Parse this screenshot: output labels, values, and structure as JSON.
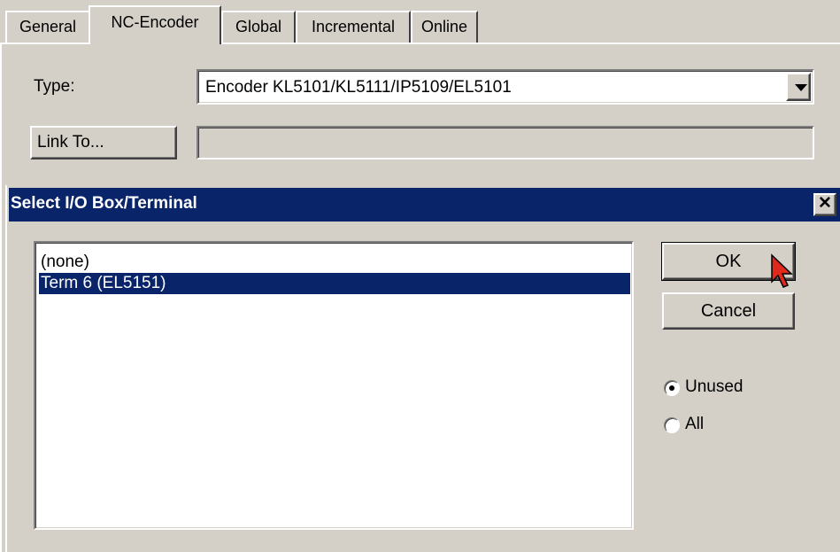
{
  "tabs": [
    {
      "label": "General",
      "active": false
    },
    {
      "label": "NC-Encoder",
      "active": true
    },
    {
      "label": "Global",
      "active": false
    },
    {
      "label": "Incremental",
      "active": false
    },
    {
      "label": "Online",
      "active": false
    }
  ],
  "form": {
    "type_label": "Type:",
    "type_value": "Encoder KL5101/KL5111/IP5109/EL5101",
    "link_to_label": "Link To...",
    "link_to_value": ""
  },
  "dialog": {
    "title": "Select I/O Box/Terminal",
    "close_glyph": "✕",
    "list_items": [
      {
        "label": "(none)",
        "selected": false
      },
      {
        "label": "Term 6 (EL5151)",
        "selected": true
      }
    ],
    "ok_label": "OK",
    "cancel_label": "Cancel",
    "radio_unused_label": "Unused",
    "radio_unused_checked": true,
    "radio_all_label": "All",
    "radio_all_checked": false
  },
  "colors": {
    "face": "#d4d0c8",
    "titlebar": "#0a246a",
    "selection": "#0a246a"
  }
}
